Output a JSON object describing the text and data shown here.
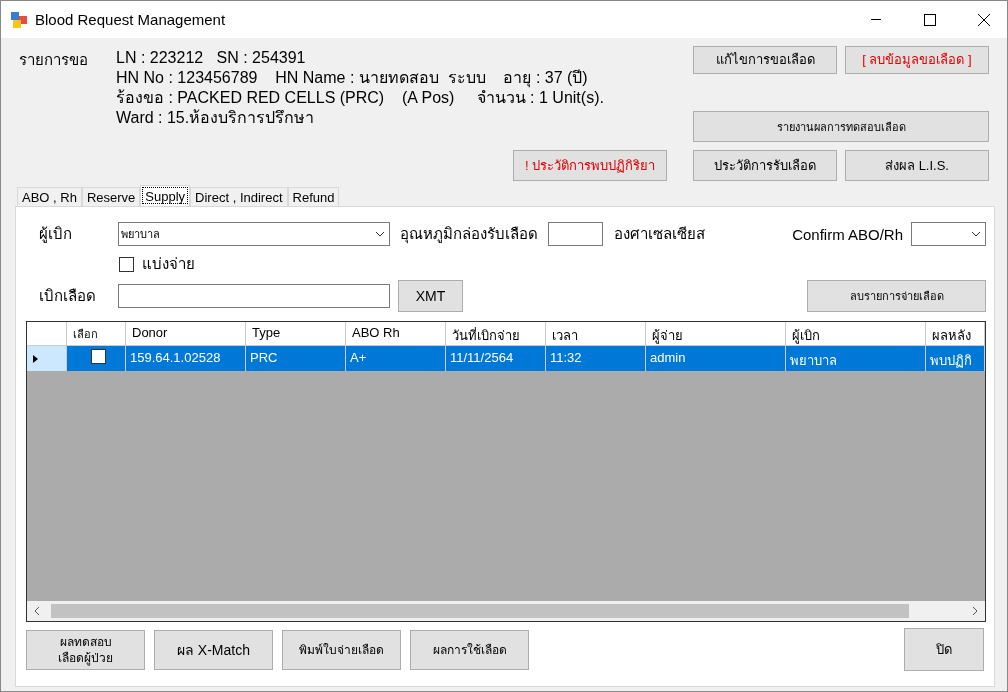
{
  "window": {
    "title": "Blood Request Management"
  },
  "request": {
    "label": "รายการขอ",
    "lines": [
      "LN : 223212   SN : 254391",
      "HN No : 123456789    HN Name : นายทดสอบ  ระบบ    อายุ : 37 (ปี)",
      "ร้องขอ : PACKED RED CELLS (PRC)    (A Pos)     จำนวน : 1 Unit(s).",
      "Ward : 15.ห้องบริการปรึกษา"
    ]
  },
  "top_buttons": [
    {
      "label": "แก้ไขการขอเลือด",
      "kind": "normal"
    },
    {
      "label": "[ ลบข้อมูลขอเลือด ]",
      "kind": "danger"
    }
  ],
  "report_button": {
    "label": "รายงานผลการทดสอบเลือด"
  },
  "action_buttons": [
    {
      "label": "! ประวัติการพบปฏิกิริยา",
      "kind": "danger"
    },
    {
      "label": "ประวัติการรับเลือด",
      "kind": "normal"
    },
    {
      "label": "ส่งผล L.I.S.",
      "kind": "normal"
    }
  ],
  "tabs": [
    {
      "label": "ABO , Rh",
      "selected": false
    },
    {
      "label": "Reserve",
      "selected": false
    },
    {
      "label": "Supply",
      "selected": true
    },
    {
      "label": "Direct , Indirect",
      "selected": false
    },
    {
      "label": "Refund",
      "selected": false
    }
  ],
  "form": {
    "requester": {
      "label": "ผู้เบิก",
      "value": "พยาบาล"
    },
    "temperature": {
      "label": "อุณหภูมิกล่องรับเลือด",
      "unit": "องศาเซลเซียส"
    },
    "confirm": {
      "label": "Confirm ABO/Rh"
    },
    "split": {
      "label": "แบ่งจ่าย",
      "checked": false
    },
    "withdraw": {
      "label": "เบิกเลือด"
    },
    "xmt_button": "XMT",
    "delete_button": "ลบรายการจ่ายเลือด"
  },
  "grid": {
    "check_column": "เลือก",
    "columns": [
      "Donor",
      "Type",
      "ABO Rh",
      "วันที่เบิกจ่าย",
      "เวลา",
      "ผู้จ่าย",
      "ผู้เบิก",
      "ผลหลัง"
    ],
    "rows": [
      {
        "selected": true,
        "checked": false,
        "cells": [
          "159.64.1.02528",
          "PRC",
          "A+",
          "11/11/2564",
          "11:32",
          "admin",
          "พยาบาล",
          "พบปฏิกิ"
        ]
      }
    ]
  },
  "footer_buttons": [
    "ผลทดสอบ\nเลือดผู้ป่วย",
    "ผล X-Match",
    "พิมพ์ใบจ่ายเลือด",
    "ผลการใช้เลือด"
  ],
  "close_button": "ปิด"
}
